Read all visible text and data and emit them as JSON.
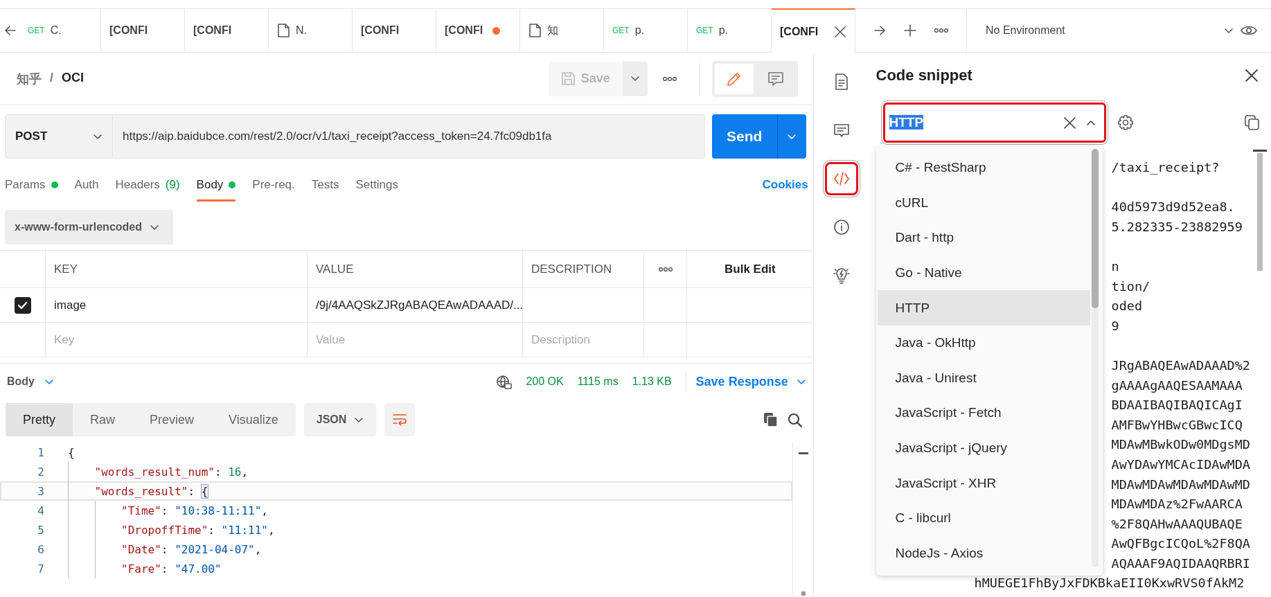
{
  "tab_bar": {
    "tabs": [
      {
        "kind": "request",
        "method": "GET",
        "title": "C.",
        "selected": false,
        "dirty": false
      },
      {
        "kind": "config",
        "title": "[CONFI",
        "selected": false,
        "dirty": false
      },
      {
        "kind": "config",
        "title": "[CONFI",
        "selected": false,
        "dirty": false
      },
      {
        "kind": "doc",
        "title": "N.",
        "selected": false,
        "dirty": false
      },
      {
        "kind": "config",
        "title": "[CONFI",
        "selected": false,
        "dirty": false
      },
      {
        "kind": "config",
        "title": "[CONFI",
        "selected": false,
        "dirty": true
      },
      {
        "kind": "doc",
        "title": "知",
        "selected": false,
        "dirty": false
      },
      {
        "kind": "request",
        "method": "GET",
        "title": "p.",
        "selected": false,
        "dirty": false
      },
      {
        "kind": "request",
        "method": "GET",
        "title": "p.",
        "selected": false,
        "dirty": false
      },
      {
        "kind": "config",
        "title": "[CONFI",
        "selected": true,
        "dirty": false
      }
    ],
    "environment": "No Environment"
  },
  "breadcrumb": {
    "parent": "知乎",
    "separator": "/",
    "current": "OCI"
  },
  "toolbar": {
    "save": {
      "label": "Save",
      "disabled": true
    },
    "modes": [
      {
        "kind": "edit",
        "selected": true
      },
      {
        "kind": "comment",
        "selected": false
      }
    ]
  },
  "request": {
    "method": "POST",
    "url": "https://aip.baidubce.com/rest/2.0/ocr/v1/taxi_receipt?access_token=24.7fc09db1fa",
    "send": "Send"
  },
  "request_tabs": [
    {
      "label": "Params",
      "dot": true,
      "selected": false
    },
    {
      "label": "Auth",
      "dot": false,
      "selected": false
    },
    {
      "label": "Headers",
      "count": "(9)",
      "dot": false,
      "selected": false
    },
    {
      "label": "Body",
      "dot": true,
      "selected": true
    },
    {
      "label": "Pre-req.",
      "dot": false,
      "selected": false
    },
    {
      "label": "Tests",
      "dot": false,
      "selected": false
    },
    {
      "label": "Settings",
      "dot": false,
      "selected": false
    }
  ],
  "cookies": "Cookies",
  "body_type": "x-www-form-urlencoded",
  "params_table": {
    "columns": [
      "KEY",
      "VALUE",
      "DESCRIPTION"
    ],
    "bulk_edit": "Bulk Edit",
    "rows": [
      {
        "key": "image",
        "value": "/9j/4AAQSkZJRgABAQEAwADAAAD/...",
        "checked": true
      }
    ],
    "new_row": {
      "key": {
        "placeholder": "Key"
      },
      "value": {
        "placeholder": "Value"
      },
      "description": {
        "placeholder": "Description"
      }
    }
  },
  "response": {
    "view": "Body",
    "status": "200 OK",
    "time": "1115 ms",
    "size": "1.13 KB",
    "save": "Save Response",
    "formats": [
      {
        "label": "Pretty",
        "selected": true
      },
      {
        "label": "Raw",
        "selected": false
      },
      {
        "label": "Preview",
        "selected": false
      },
      {
        "label": "Visualize",
        "selected": false
      }
    ],
    "language": "JSON",
    "wrap_lines": true,
    "code": [
      {
        "number": "1",
        "current": false,
        "tokens": [
          {
            "kind": "punct",
            "text": "{"
          }
        ],
        "children": [
          {
            "number": "2",
            "current": false,
            "tokens": [
              {
                "kind": "key",
                "text": "\"words_result_num\""
              },
              {
                "kind": "punct",
                "text": ": "
              },
              {
                "kind": "number",
                "text": "16"
              },
              {
                "kind": "punct",
                "text": ","
              }
            ]
          },
          {
            "number": "3",
            "current": true,
            "tokens": [
              {
                "kind": "key",
                "text": "\"words_result\""
              },
              {
                "kind": "punct",
                "text": ": "
              },
              {
                "kind": "bracket",
                "text": "{"
              }
            ],
            "children": [
              {
                "number": "4",
                "current": false,
                "tokens": [
                  {
                    "kind": "key",
                    "text": "\"Time\""
                  },
                  {
                    "kind": "punct",
                    "text": ": "
                  },
                  {
                    "kind": "string",
                    "text": "\"10:38-11:11\""
                  },
                  {
                    "kind": "punct",
                    "text": ","
                  }
                ]
              },
              {
                "number": "5",
                "current": false,
                "tokens": [
                  {
                    "kind": "key",
                    "text": "\"DropoffTime\""
                  },
                  {
                    "kind": "punct",
                    "text": ": "
                  },
                  {
                    "kind": "string",
                    "text": "\"11:11\""
                  },
                  {
                    "kind": "punct",
                    "text": ","
                  }
                ]
              },
              {
                "number": "6",
                "current": false,
                "tokens": [
                  {
                    "kind": "key",
                    "text": "\"Date\""
                  },
                  {
                    "kind": "punct",
                    "text": ": "
                  },
                  {
                    "kind": "string",
                    "text": "\"2021-04-07\""
                  },
                  {
                    "kind": "punct",
                    "text": ","
                  }
                ]
              },
              {
                "number": "7",
                "current": false,
                "tokens": [
                  {
                    "kind": "key",
                    "text": "\"Fare\""
                  },
                  {
                    "kind": "punct",
                    "text": ": "
                  },
                  {
                    "kind": "string",
                    "text": "\"47.00\""
                  }
                ]
              }
            ]
          }
        ]
      }
    ]
  },
  "side_icons": [
    {
      "kind": "doc",
      "selected": false,
      "highlighted": false
    },
    {
      "kind": "comment",
      "selected": false,
      "highlighted": false
    },
    {
      "kind": "code",
      "selected": true,
      "highlighted": true
    },
    {
      "kind": "info",
      "selected": false,
      "highlighted": false
    },
    {
      "kind": "bulb",
      "selected": false,
      "highlighted": false
    }
  ],
  "code_snippet": {
    "title": "Code snippet",
    "search": {
      "value": "HTTP",
      "text_selected": true,
      "highlighted": true
    },
    "languages": [
      {
        "label": "C# - RestSharp",
        "selected": false
      },
      {
        "label": "cURL",
        "selected": false
      },
      {
        "label": "Dart - http",
        "selected": false
      },
      {
        "label": "Go - Native",
        "selected": false
      },
      {
        "label": "HTTP",
        "selected": true
      },
      {
        "label": "Java - OkHttp",
        "selected": false
      },
      {
        "label": "Java - Unirest",
        "selected": false
      },
      {
        "label": "JavaScript - Fetch",
        "selected": false
      },
      {
        "label": "JavaScript - jQuery",
        "selected": false
      },
      {
        "label": "JavaScript - XHR",
        "selected": false
      },
      {
        "label": "C - libcurl",
        "selected": false
      },
      {
        "label": "NodeJs - Axios",
        "selected": false
      }
    ],
    "lines": [
      {
        "kind": "clipped",
        "text": "/taxi_receipt?"
      },
      {
        "kind": "blank"
      },
      {
        "kind": "clipped",
        "text": "40d5973d9d52ea8."
      },
      {
        "kind": "clipped",
        "text": "5.282335-23882959"
      },
      {
        "kind": "blank"
      },
      {
        "kind": "clipped",
        "text": "n"
      },
      {
        "kind": "clipped",
        "text": "tion/"
      },
      {
        "kind": "clipped",
        "text": "oded"
      },
      {
        "kind": "clipped",
        "text": "9"
      },
      {
        "kind": "blank"
      },
      {
        "kind": "clipped",
        "text": "JRgABAQEAwADAAAD%2"
      },
      {
        "kind": "clipped",
        "text": "gAAAAgAAQESAAMAAA"
      },
      {
        "kind": "clipped",
        "text": "BDAAIBAQIBAQICAgI"
      },
      {
        "kind": "clipped",
        "text": "AMFBwYHBwcGBwcICQ"
      },
      {
        "kind": "clipped",
        "text": "MDAwMBwkODw0MDgsMD"
      },
      {
        "kind": "clipped",
        "text": "AwYDAwYMCAcIDAwMDA"
      },
      {
        "kind": "clipped",
        "text": "MDAwMDAwMDAwMDAwMD"
      },
      {
        "kind": "clipped",
        "text": "MDAwMDAz%2FwAARCA"
      },
      {
        "kind": "clipped",
        "text": "%2F8QAHwAAAQUBAQE"
      },
      {
        "kind": "clipped",
        "text": "AwQFBgcICQoL%2F8QA"
      },
      {
        "kind": "clipped",
        "text": "AQAAAF9AQIDAAQRBRI"
      },
      {
        "kind": "full",
        "text": "hMUEGE1FhByJxFDKBkaEII0KxwRVS0fAkM2"
      }
    ]
  }
}
